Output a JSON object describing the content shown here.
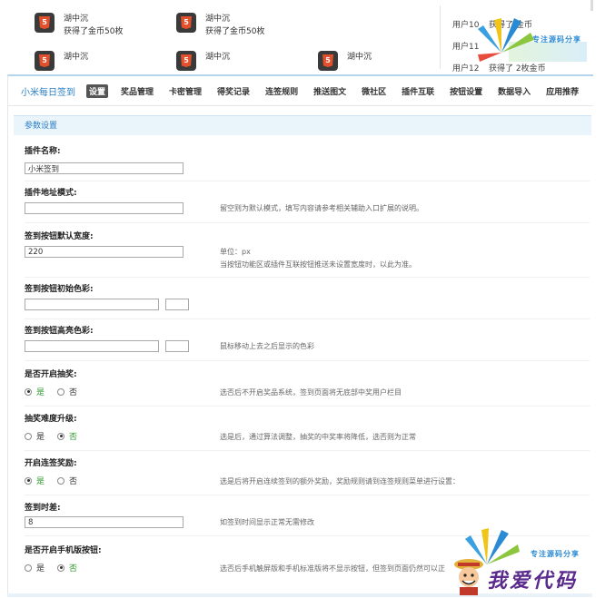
{
  "preview": {
    "items": [
      {
        "name": "湖中沉",
        "desc": "获得了金币50枚"
      },
      {
        "name": "湖中沉",
        "desc": "获得了金币50枚"
      },
      {
        "name": "湖中沉",
        "desc": ""
      },
      {
        "name": "湖中沉",
        "desc": ""
      },
      {
        "name": "湖中沉",
        "desc": ""
      }
    ],
    "h5_label": "5",
    "users": [
      {
        "user": "用户10",
        "action": "获得了 金币"
      },
      {
        "user": "用户11",
        "action": ""
      },
      {
        "user": "用户12",
        "action": "获得了 2枚金币"
      }
    ],
    "logo_caption": "专注源码分享"
  },
  "nav": {
    "title": "小米每日签到",
    "tabs": [
      {
        "label": "设置",
        "active": true
      },
      {
        "label": "奖品管理",
        "active": false
      },
      {
        "label": "卡密管理",
        "active": false
      },
      {
        "label": "得奖记录",
        "active": false
      },
      {
        "label": "连签规则",
        "active": false
      },
      {
        "label": "推送图文",
        "active": false
      },
      {
        "label": "微社区",
        "active": false
      },
      {
        "label": "插件互联",
        "active": false
      },
      {
        "label": "按钮设置",
        "active": false
      },
      {
        "label": "数据导入",
        "active": false
      },
      {
        "label": "应用推荐",
        "active": false
      }
    ]
  },
  "section_title": "参数设置",
  "fields": {
    "plugin_name": {
      "label": "插件名称:",
      "value": "小米签到"
    },
    "plugin_url_mode": {
      "label": "插件地址模式:",
      "value": "",
      "hint": "留空则为默认模式，填写内容请参考相关辅助入口扩展的说明。"
    },
    "button_width": {
      "label": "签到按钮默认宽度:",
      "value": "220",
      "hint1": "单位：px",
      "hint2": "当按钮功能区或插件互联按钮推送未设置宽度时，以此为准。"
    },
    "button_color": {
      "label": "签到按钮初始色彩:",
      "value": ""
    },
    "button_highlight": {
      "label": "签到按钮高亮色彩:",
      "value": "",
      "hint": "鼠标移动上去之后显示的色彩"
    },
    "enable_lottery": {
      "label": "是否开启抽奖:",
      "yes": "是",
      "no": "否",
      "selected": "yes",
      "hint": "选否后不开启奖品系统，签到页面将无底部中奖用户栏目"
    },
    "lottery_upgrade": {
      "label": "抽奖难度升级:",
      "yes": "是",
      "no": "否",
      "selected": "no",
      "hint": "选是后，通过算法调整，抽奖的中奖率将降低，选否则为正常"
    },
    "consecutive_reward": {
      "label": "开启连签奖励:",
      "yes": "是",
      "no": "否",
      "selected": "yes",
      "hint": "选是后将开启连续签到的额外奖励，奖励规则请到连签规则菜单进行设置："
    },
    "time_diff": {
      "label": "签到时差:",
      "value": "8",
      "hint": "如签到时间显示正常无需修改"
    },
    "mobile_button": {
      "label": "是否开启手机版按钮:",
      "yes": "是",
      "no": "否",
      "selected": "no",
      "hint": "选否后手机触屏版和手机标准版将不显示按钮，但签到页面仍然可以正"
    }
  },
  "watermark": {
    "caption": "专注源码分享",
    "text": "我爱代码"
  },
  "colors": {
    "accent": "#2b7fc3",
    "selected_green": "#2d9a2d",
    "section_bg": "#eaf4fb",
    "watermark": "#5a2a8c"
  }
}
